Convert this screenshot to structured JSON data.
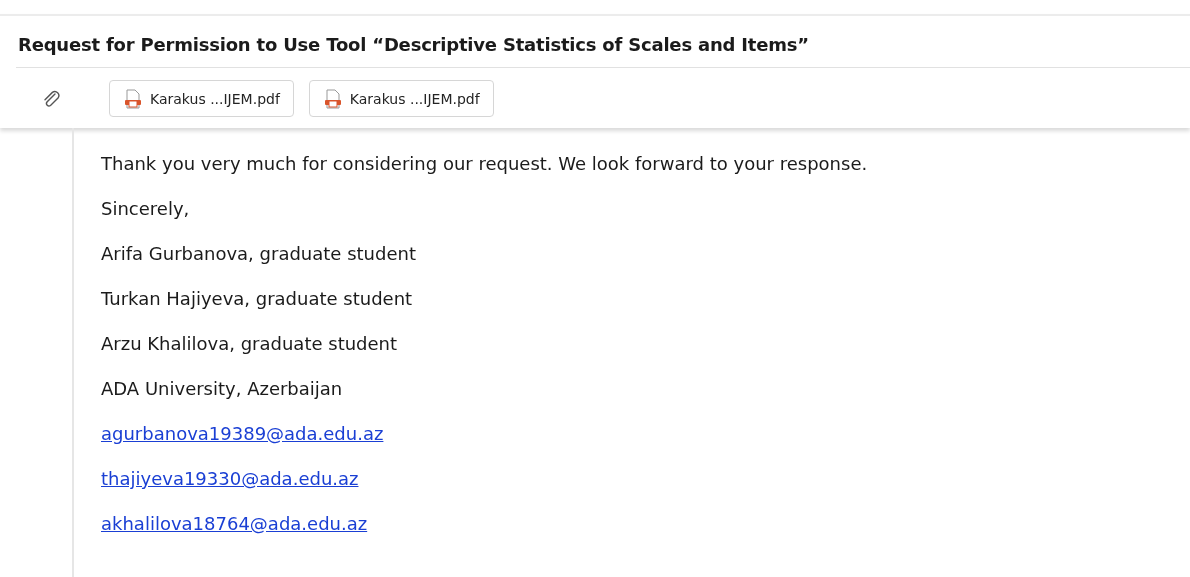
{
  "subject": "Request for Permission to Use Tool “Descriptive Statistics of Scales and Items”",
  "attachments": [
    {
      "name": "Karakus ...IJEM.pdf"
    },
    {
      "name": "Karakus ...IJEM.pdf"
    }
  ],
  "body": [
    {
      "kind": "text",
      "text": "Thank you very much for considering our request. We look forward to your response."
    },
    {
      "kind": "text",
      "text": "Sincerely,"
    },
    {
      "kind": "text",
      "text": "Arifa Gurbanova, graduate student"
    },
    {
      "kind": "text",
      "text": "Turkan Hajiyeva, graduate student"
    },
    {
      "kind": "text",
      "text": "Arzu Khalilova, graduate student"
    },
    {
      "kind": "text",
      "text": "ADA University, Azerbaijan"
    },
    {
      "kind": "link",
      "text": "agurbanova19389@ada.edu.az"
    },
    {
      "kind": "link",
      "text": "thajiyeva19330@ada.edu.az"
    },
    {
      "kind": "link",
      "text": "akhalilova18764@ada.edu.az"
    }
  ]
}
